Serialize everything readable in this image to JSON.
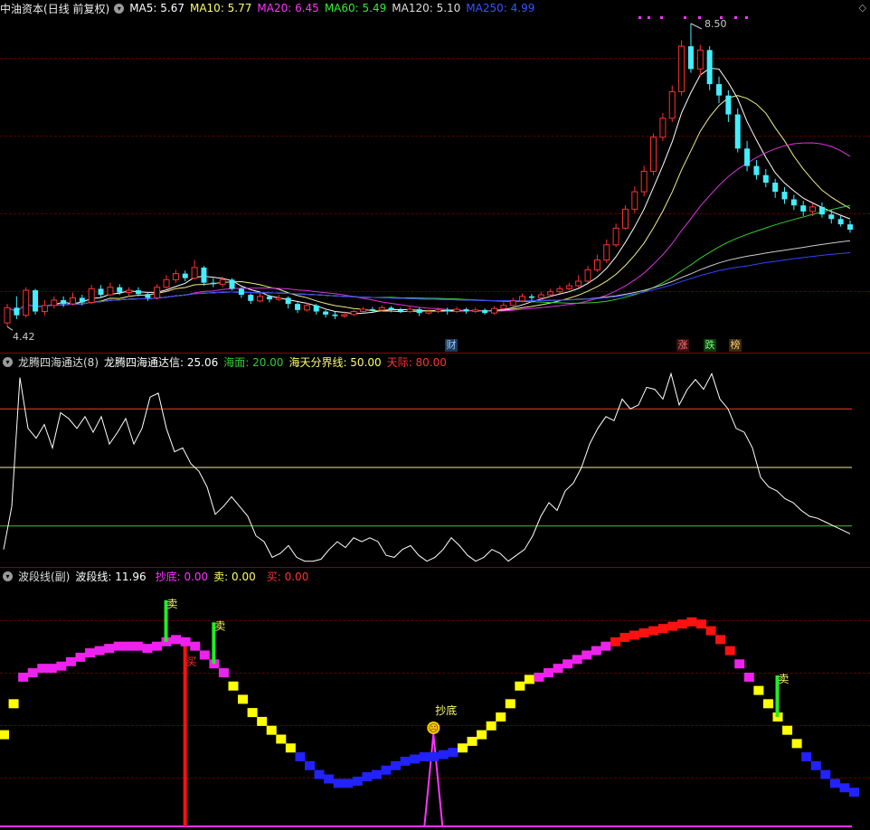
{
  "main": {
    "stock_name": "中油资本",
    "period": "(日线 前复权)",
    "ma": [
      {
        "label": "MA5: 5.67",
        "color": "#ffffff"
      },
      {
        "label": "MA10: 5.77",
        "color": "#ffff66"
      },
      {
        "label": "MA20: 6.45",
        "color": "#ff33ff"
      },
      {
        "label": "MA60: 5.49",
        "color": "#33ee33"
      },
      {
        "label": "MA120: 5.10",
        "color": "#dddddd"
      },
      {
        "label": "MA250: 4.99",
        "color": "#3355ff"
      }
    ],
    "high_label": "8.50",
    "low_label": "4.42",
    "events": {
      "cai": "财",
      "zhang": "涨",
      "die": "跌",
      "bang": "榜"
    },
    "candles": [
      [
        4.55,
        4.75,
        4.8,
        4.5
      ],
      [
        4.75,
        4.65,
        4.9,
        4.6
      ],
      [
        4.65,
        4.98,
        5.02,
        4.62
      ],
      [
        4.98,
        4.7,
        5.0,
        4.66
      ],
      [
        4.7,
        4.78,
        4.85,
        4.65
      ],
      [
        4.78,
        4.85,
        4.9,
        4.74
      ],
      [
        4.85,
        4.8,
        4.9,
        4.76
      ],
      [
        4.8,
        4.88,
        4.95,
        4.78
      ],
      [
        4.88,
        4.82,
        4.92,
        4.78
      ],
      [
        4.82,
        5.0,
        5.05,
        4.8
      ],
      [
        5.0,
        4.92,
        5.05,
        4.88
      ],
      [
        4.92,
        5.02,
        5.08,
        4.9
      ],
      [
        5.02,
        4.95,
        5.06,
        4.92
      ],
      [
        4.95,
        4.98,
        5.02,
        4.9
      ],
      [
        4.98,
        4.93,
        5.02,
        4.9
      ],
      [
        4.93,
        4.88,
        4.96,
        4.84
      ],
      [
        4.88,
        5.02,
        5.06,
        4.86
      ],
      [
        5.02,
        5.12,
        5.18,
        5.0
      ],
      [
        5.12,
        5.2,
        5.25,
        5.08
      ],
      [
        5.2,
        5.14,
        5.24,
        5.1
      ],
      [
        5.14,
        5.28,
        5.38,
        5.12
      ],
      [
        5.28,
        5.08,
        5.3,
        5.04
      ],
      [
        5.08,
        5.06,
        5.14,
        5.02
      ],
      [
        5.06,
        5.12,
        5.16,
        5.02
      ],
      [
        5.12,
        5.0,
        5.14,
        4.98
      ],
      [
        5.0,
        4.92,
        5.02,
        4.88
      ],
      [
        4.92,
        4.84,
        4.94,
        4.8
      ],
      [
        4.84,
        4.9,
        4.94,
        4.82
      ],
      [
        4.9,
        4.86,
        4.92,
        4.82
      ],
      [
        4.86,
        4.88,
        4.92,
        4.84
      ],
      [
        4.88,
        4.8,
        4.9,
        4.74
      ],
      [
        4.8,
        4.72,
        4.82,
        4.68
      ],
      [
        4.72,
        4.78,
        4.82,
        4.7
      ],
      [
        4.78,
        4.7,
        4.8,
        4.66
      ],
      [
        4.7,
        4.66,
        4.72,
        4.62
      ],
      [
        4.66,
        4.64,
        4.7,
        4.6
      ],
      [
        4.64,
        4.66,
        4.7,
        4.62
      ],
      [
        4.66,
        4.7,
        4.72,
        4.64
      ],
      [
        4.7,
        4.73,
        4.76,
        4.68
      ],
      [
        4.73,
        4.72,
        4.76,
        4.7
      ],
      [
        4.72,
        4.75,
        4.78,
        4.7
      ],
      [
        4.75,
        4.72,
        4.77,
        4.69
      ],
      [
        4.72,
        4.7,
        4.75,
        4.68
      ],
      [
        4.7,
        4.73,
        4.76,
        4.68
      ],
      [
        4.73,
        4.68,
        4.75,
        4.64
      ],
      [
        4.68,
        4.7,
        4.73,
        4.66
      ],
      [
        4.7,
        4.72,
        4.75,
        4.68
      ],
      [
        4.72,
        4.7,
        4.75,
        4.66
      ],
      [
        4.7,
        4.73,
        4.76,
        4.68
      ],
      [
        4.73,
        4.7,
        4.75,
        4.67
      ],
      [
        4.7,
        4.72,
        4.75,
        4.68
      ],
      [
        4.72,
        4.68,
        4.74,
        4.66
      ],
      [
        4.68,
        4.74,
        4.77,
        4.66
      ],
      [
        4.74,
        4.78,
        4.82,
        4.72
      ],
      [
        4.78,
        4.84,
        4.88,
        4.76
      ],
      [
        4.84,
        4.9,
        4.94,
        4.82
      ],
      [
        4.9,
        4.88,
        4.93,
        4.84
      ],
      [
        4.88,
        4.92,
        4.96,
        4.86
      ],
      [
        4.92,
        4.96,
        5.0,
        4.9
      ],
      [
        4.96,
        5.0,
        5.04,
        4.94
      ],
      [
        5.0,
        5.04,
        5.08,
        4.98
      ],
      [
        5.04,
        5.1,
        5.18,
        5.02
      ],
      [
        5.1,
        5.25,
        5.3,
        5.08
      ],
      [
        5.25,
        5.38,
        5.45,
        5.22
      ],
      [
        5.38,
        5.58,
        5.65,
        5.34
      ],
      [
        5.58,
        5.8,
        5.86,
        5.55
      ],
      [
        5.8,
        6.05,
        6.1,
        5.78
      ],
      [
        6.05,
        6.28,
        6.35,
        6.0
      ],
      [
        6.28,
        6.55,
        6.62,
        6.22
      ],
      [
        6.55,
        7.0,
        7.05,
        6.5
      ],
      [
        7.0,
        7.25,
        7.32,
        6.95
      ],
      [
        7.25,
        7.6,
        7.68,
        7.2
      ],
      [
        7.6,
        8.2,
        8.28,
        7.55
      ],
      [
        8.2,
        7.9,
        8.5,
        7.85
      ],
      [
        7.9,
        8.15,
        8.22,
        7.8
      ],
      [
        8.15,
        7.7,
        8.2,
        7.62
      ],
      [
        7.7,
        7.55,
        7.8,
        7.45
      ],
      [
        7.55,
        7.3,
        7.62,
        7.2
      ],
      [
        7.3,
        6.85,
        7.38,
        6.8
      ],
      [
        6.85,
        6.62,
        6.95,
        6.55
      ],
      [
        6.62,
        6.5,
        6.7,
        6.44
      ],
      [
        6.5,
        6.4,
        6.58,
        6.34
      ],
      [
        6.4,
        6.28,
        6.45,
        6.2
      ],
      [
        6.28,
        6.18,
        6.34,
        6.12
      ],
      [
        6.18,
        6.1,
        6.24,
        6.04
      ],
      [
        6.1,
        6.02,
        6.16,
        5.96
      ],
      [
        6.02,
        6.08,
        6.12,
        5.96
      ],
      [
        6.08,
        5.98,
        6.14,
        5.94
      ],
      [
        5.98,
        5.92,
        6.04,
        5.86
      ],
      [
        5.92,
        5.85,
        5.96,
        5.82
      ],
      [
        5.85,
        5.78,
        5.9,
        5.74
      ]
    ]
  },
  "osc": {
    "indicator_name": "龙腾四海通达(8)",
    "value_label": "龙腾四海通达信: 25.06",
    "lines": [
      {
        "label": "海面: 20.00",
        "value": 20,
        "color": "#33cc33"
      },
      {
        "label": "海天分界线: 50.00",
        "value": 50,
        "color": "#eeee99"
      },
      {
        "label": "天际: 80.00",
        "value": 80,
        "color": "#ff3333"
      }
    ],
    "label_colors": [
      "#33cc33",
      "#ffff66",
      "#ff3333"
    ],
    "series": [
      8,
      30,
      96,
      70,
      65,
      72,
      60,
      78,
      75,
      70,
      76,
      68,
      76,
      62,
      68,
      75,
      62,
      70,
      86,
      88,
      70,
      58,
      60,
      52,
      48,
      40,
      26,
      30,
      35,
      30,
      25,
      15,
      12,
      4,
      6,
      10,
      4,
      2,
      2,
      3,
      8,
      12,
      9,
      14,
      12,
      14,
      12,
      5,
      4,
      8,
      10,
      5,
      2,
      4,
      8,
      14,
      10,
      5,
      2,
      4,
      8,
      6,
      2,
      5,
      8,
      15,
      25,
      32,
      28,
      38,
      42,
      50,
      62,
      70,
      76,
      74,
      85,
      80,
      82,
      91,
      90,
      85,
      98,
      82,
      90,
      95,
      90,
      98,
      85,
      80,
      70,
      68,
      60,
      45,
      40,
      38,
      34,
      32,
      28,
      25,
      24,
      22,
      20,
      18,
      16
    ]
  },
  "wave": {
    "title": "波段线(副)",
    "value_label": "波段线: 11.96",
    "chaodi_label": "抄底: 0.00",
    "mai_label": "卖: 0.00",
    "mai2_label": "买: 0.00",
    "sell_text": "卖",
    "buy_text": "买",
    "chaodi_text": "抄底",
    "emoji": "☹",
    "series": [
      30,
      44,
      56,
      58,
      60,
      60,
      61,
      63,
      65,
      67,
      68,
      69,
      70,
      70,
      70,
      69,
      70,
      72,
      73,
      72,
      70,
      66,
      62,
      58,
      52,
      46,
      40,
      36,
      32,
      28,
      24,
      20,
      16,
      12,
      10,
      8,
      8,
      9,
      11,
      12,
      14,
      16,
      18,
      19,
      20,
      20,
      21,
      22,
      24,
      27,
      30,
      34,
      38,
      44,
      52,
      55,
      56,
      58,
      60,
      62,
      64,
      66,
      68,
      70,
      72,
      74,
      75,
      76,
      77,
      78,
      79,
      80,
      81,
      80,
      77,
      73,
      68,
      62,
      56,
      50,
      44,
      38,
      32,
      26,
      20,
      16,
      12,
      8,
      6,
      4
    ],
    "sell_indices": [
      17,
      22,
      81
    ],
    "buy_index": 19,
    "chaodi_index": 45
  }
}
